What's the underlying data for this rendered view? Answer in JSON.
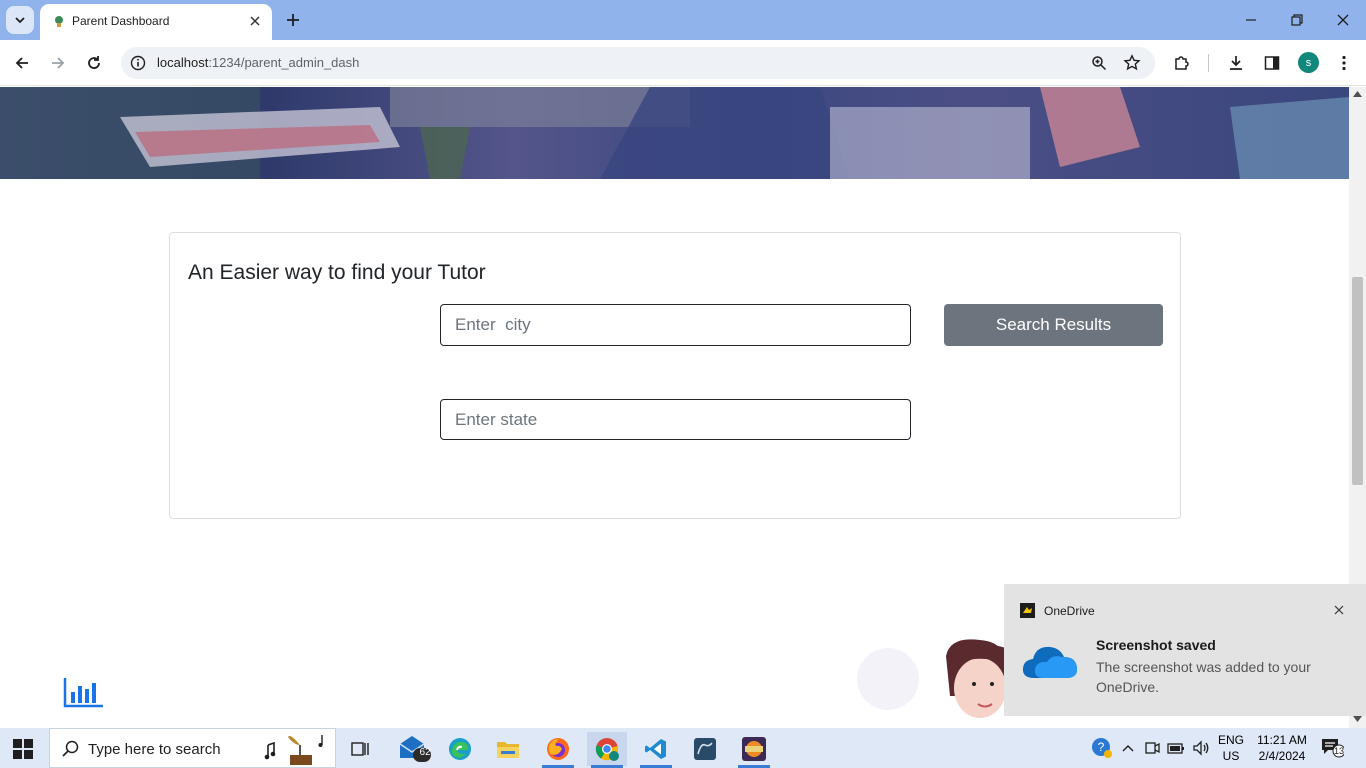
{
  "browser": {
    "tab_title": "Parent Dashboard",
    "url_host": "localhost",
    "url_path": ":1234/parent_admin_dash",
    "avatar_letter": "s"
  },
  "page": {
    "card_title": "An Easier way to find your Tutor",
    "city_placeholder": "Enter  city",
    "state_placeholder": "Enter state",
    "search_button": "Search Results"
  },
  "toast": {
    "app_name": "OneDrive",
    "title": "Screenshot saved",
    "body": "The screenshot was added to your OneDrive."
  },
  "taskbar": {
    "search_placeholder": "Type here to search",
    "mail_badge": "62",
    "lang_line1": "ENG",
    "lang_line2": "US",
    "time": "11:21 AM",
    "date": "2/4/2024",
    "notification_count": "13"
  },
  "colors": {
    "tabstrip": "#8fb3ea",
    "search_button": "#6c757d",
    "accent_blue": "#1a73e8"
  }
}
